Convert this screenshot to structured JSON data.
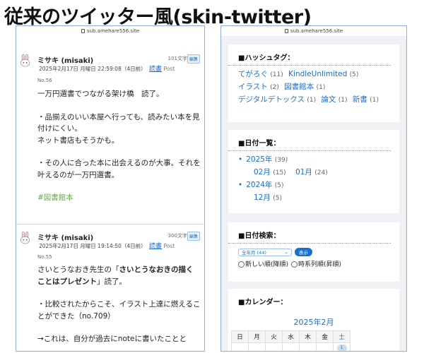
{
  "heading": "従来のツイッター風(skin-twitter)",
  "url": "sub.amehare556.site",
  "posts": [
    {
      "author": "ミサキ (misaki)",
      "chars": "101文字",
      "edit": "編集",
      "date": "2025年2月17日 月曜日 22:59:08（4日前）",
      "category": "読書",
      "post_label": "Post",
      "post_no": "No.56",
      "lines": [
        "一万円選書でつながる架け橋　読了。",
        "",
        "・品揃えのいい本屋へ行っても、読みたい本を見付けにくい。",
        "ネット書店もそうかも。",
        "",
        "・その人に合った本に出会えるのが大事。それを叶えるのが一万円選書。",
        ""
      ],
      "tag": "#図書館本"
    },
    {
      "author": "ミサキ (misaki)",
      "chars": "300文字",
      "edit": "編集",
      "date": "2025年2月17日 月曜日 19:14:50（4日前）",
      "category": "読書",
      "post_label": "Post",
      "post_no": "No.55",
      "line1": "さいとうなおき先生の「",
      "line1_bold": "さいとうなおきの描く",
      "line2_bold": "ことはプレゼント",
      "line2_rest": "」読了。",
      "lines_after": [
        "",
        "・比較されたからこそ、イラスト上達に燃えることができた（no.709）",
        "",
        "→これは、自分が過去にnoteに書いたことと"
      ]
    }
  ],
  "hashtags": {
    "title": "■ハッシュタグ：",
    "items": [
      {
        "label": "てがろぐ",
        "count": "(11)"
      },
      {
        "label": "KindleUnlimited",
        "count": "(5)"
      },
      {
        "label": "イラスト",
        "count": "(2)"
      },
      {
        "label": "図書館本",
        "count": "(1)"
      },
      {
        "label": "デジタルデトックス",
        "count": "(1)"
      },
      {
        "label": "論文",
        "count": "(1)"
      },
      {
        "label": "新書",
        "count": "(1)"
      }
    ]
  },
  "dates": {
    "title": "■日付一覧：",
    "year1": "2025年",
    "year1_count": "(39)",
    "m1": "02月",
    "m1_count": "(15)",
    "m2": "01月",
    "m2_count": "(24)",
    "year2": "2024年",
    "year2_count": "(5)",
    "m3": "12月",
    "m3_count": "(5)"
  },
  "date_search": {
    "title": "■日付検索：",
    "select_value": "全年月 (44)",
    "show_button": "表示",
    "radio1": "新しい順(降順)",
    "radio2": "時系列順(昇順)"
  },
  "calendar": {
    "title": "■カレンダー：",
    "month": "2025年2月",
    "weekdays": [
      "日",
      "月",
      "火",
      "水",
      "木",
      "金",
      "土"
    ],
    "first_day": "1"
  }
}
